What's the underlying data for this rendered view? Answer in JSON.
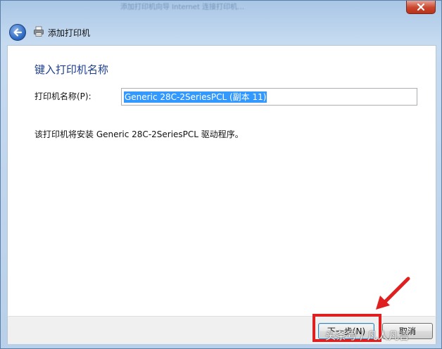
{
  "window": {
    "background_title": "添加打印机向导 Internet 连接打印机…",
    "close_symbol": "✕"
  },
  "nav": {
    "wizard_title": "添加打印机"
  },
  "main": {
    "heading": "键入打印机名称",
    "printer_name_label": "打印机名称(P):",
    "printer_name_value": "Generic 28C-2SeriesPCL (副本 11)",
    "driver_info": "该打印机将安装 Generic 28C-2SeriesPCL 驱动程序。"
  },
  "footer": {
    "next_label": "下一步(N)",
    "cancel_label": "取消"
  },
  "annotation": {
    "highlight_color": "#e02020",
    "watermark": "头条号 / 凡人凡言"
  },
  "colors": {
    "heading": "#1e3f8f",
    "selection": "#3399ff",
    "close": "#c9452c"
  }
}
